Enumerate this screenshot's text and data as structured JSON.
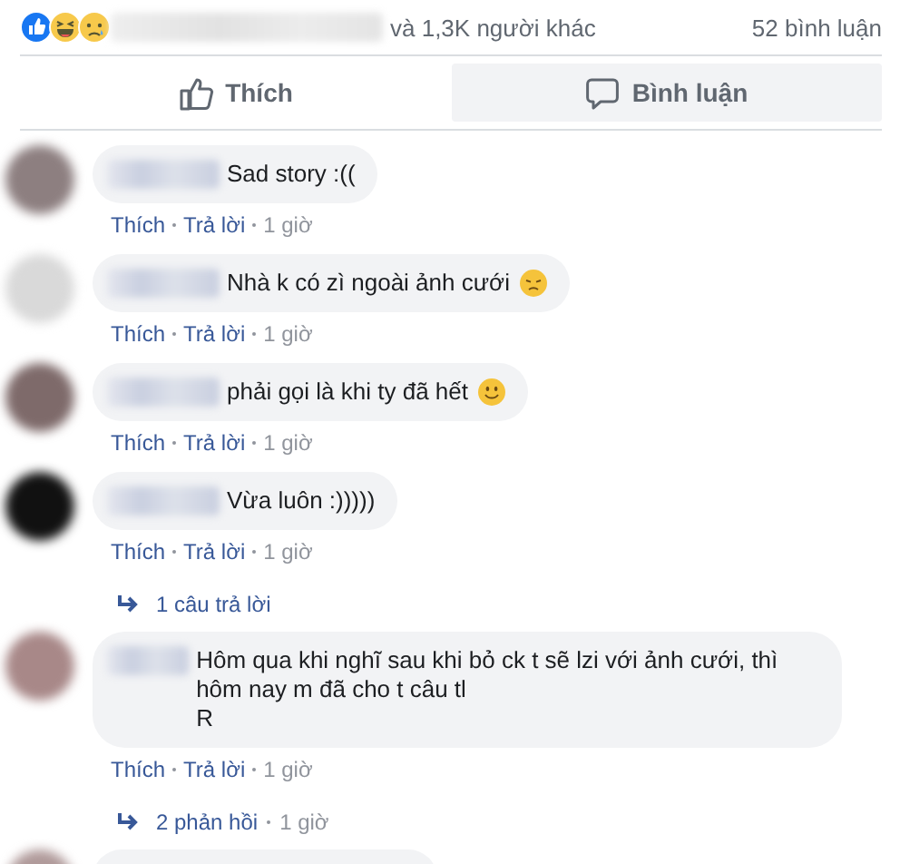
{
  "summary": {
    "reactions": [
      {
        "kind": "like"
      },
      {
        "kind": "haha"
      },
      {
        "kind": "sad"
      }
    ],
    "others": "và 1,3K người khác",
    "comment_count": "52 bình luận"
  },
  "actions": [
    {
      "label": "Thích",
      "hovered": false
    },
    {
      "label": "Bình luận",
      "hovered": true
    }
  ],
  "comments": [
    {
      "text": "Sad story :((",
      "actions": [
        "Thích",
        "Trả lời"
      ],
      "time": "1 giờ"
    },
    {
      "text": "Nhà k có zì ngoài ảnh cưới",
      "emoji": {
        "kind": "sad"
      },
      "actions": [
        "Thích",
        "Trả lời"
      ],
      "time": "1 giờ"
    },
    {
      "text": "phải gọi là khi ty đã hết",
      "emoji": {
        "kind": "smile"
      },
      "actions": [
        "Thích",
        "Trả lời"
      ],
      "time": "1 giờ"
    },
    {
      "text": "Vừa luôn :)))))",
      "actions": [
        "Thích",
        "Trả lời"
      ],
      "time": "1 giờ",
      "replies": {
        "label": "1 câu trả lời"
      }
    },
    {
      "text": "Hôm qua khi nghĩ sau khi bỏ ck t sẽ lzi với ảnh cưới, thì hôm nay m đã cho t câu tl\nR",
      "actions": [
        "Thích",
        "Trả lời"
      ],
      "time": "1 giờ",
      "replies": {
        "label": "2 phản hồi",
        "time": "1 giờ"
      }
    },
    {
      "kind": "cut"
    }
  ]
}
